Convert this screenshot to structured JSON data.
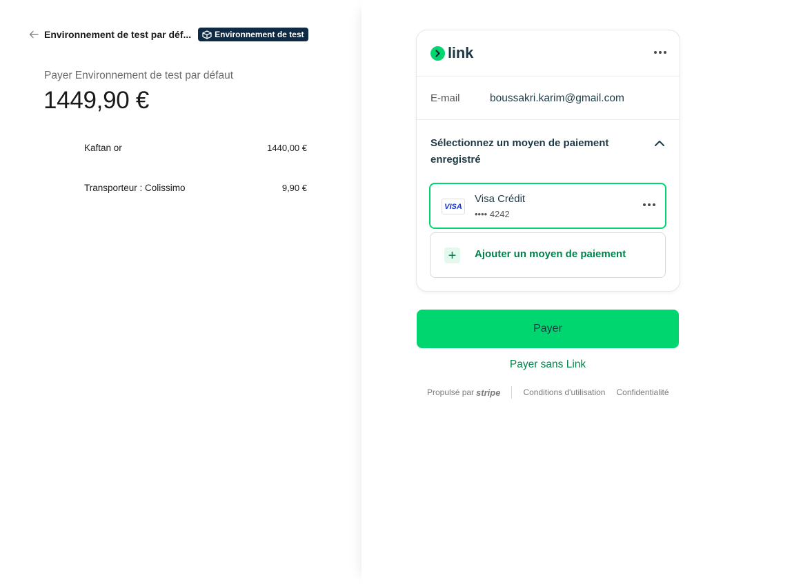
{
  "header": {
    "merchant_name": "Environnement de test par déf...",
    "test_badge": "Environnement de test"
  },
  "summary": {
    "pay_label": "Payer Environnement de test par défaut",
    "amount": "1449,90 €",
    "items": [
      {
        "name": "Kaftan or",
        "price": "1440,00 €"
      },
      {
        "name": "Transporteur : Colissimo",
        "price": "9,90 €"
      }
    ]
  },
  "link": {
    "logo_text": "link",
    "email_label": "E-mail",
    "email_value": "boussakri.karim@gmail.com",
    "select_title": "Sélectionnez un moyen de paiement enregistré",
    "card": {
      "brand": "VISA",
      "name": "Visa Crédit",
      "number": "•••• 4242"
    },
    "add_payment_label": "Ajouter un moyen de paiement"
  },
  "actions": {
    "pay_label": "Payer",
    "pay_without_link": "Payer sans Link"
  },
  "footer": {
    "powered_by": "Propulsé par",
    "stripe": "stripe",
    "terms": "Conditions d'utilisation",
    "privacy": "Confidentialité"
  },
  "colors": {
    "accent": "#00d66f",
    "link_green": "#00824a",
    "badge_bg": "#0f2a44",
    "text_dark": "#1d3944"
  }
}
